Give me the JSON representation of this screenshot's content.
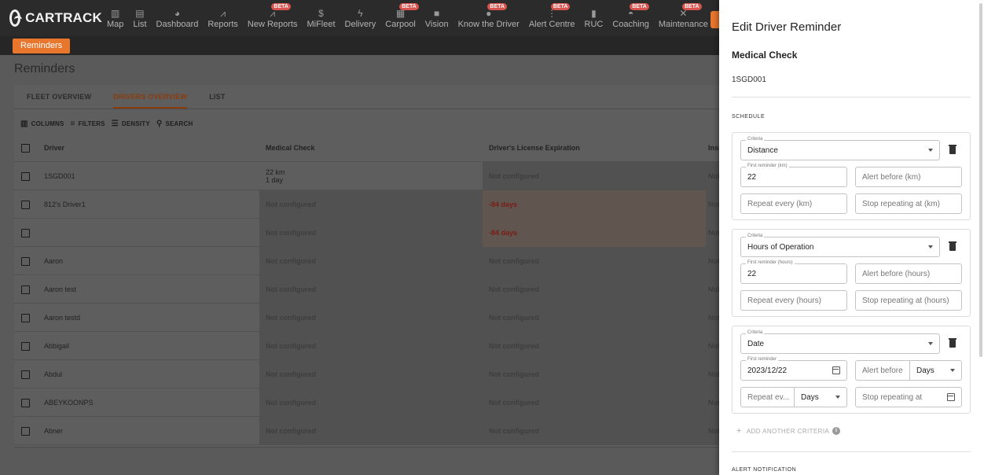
{
  "brand": {
    "name": "CARTRACK"
  },
  "nav": {
    "items": [
      {
        "label": "Map",
        "icon": "map-icon",
        "glyph": "▥",
        "beta": false
      },
      {
        "label": "List",
        "icon": "list-icon",
        "glyph": "▤",
        "beta": false
      },
      {
        "label": "Dashboard",
        "icon": "dashboard-icon",
        "glyph": "◕",
        "beta": false
      },
      {
        "label": "Reports",
        "icon": "reports-icon",
        "glyph": "⩘",
        "beta": false
      },
      {
        "label": "New Reports",
        "icon": "new-reports-icon",
        "glyph": "⩘",
        "beta": true
      },
      {
        "label": "MiFleet",
        "icon": "mifleet-icon",
        "glyph": "$",
        "beta": false
      },
      {
        "label": "Delivery",
        "icon": "delivery-icon",
        "glyph": "ϟ",
        "beta": false
      },
      {
        "label": "Carpool",
        "icon": "carpool-icon",
        "glyph": "▦",
        "beta": true
      },
      {
        "label": "Vision",
        "icon": "vision-icon",
        "glyph": "■",
        "beta": false
      },
      {
        "label": "Know the Driver",
        "icon": "driver-icon",
        "glyph": "●",
        "beta": true
      },
      {
        "label": "Alert Centre",
        "icon": "alert-icon",
        "glyph": "⋮",
        "beta": true
      },
      {
        "label": "RUC",
        "icon": "ruc-icon",
        "glyph": "▮",
        "beta": false
      },
      {
        "label": "Coaching",
        "icon": "coaching-icon",
        "glyph": "◓",
        "beta": true
      },
      {
        "label": "Maintenance",
        "icon": "maintenance-icon",
        "glyph": "✕",
        "beta": true
      }
    ],
    "beta_label": "BETA"
  },
  "subnav": {
    "button": "Reminders"
  },
  "page": {
    "title": "Reminders"
  },
  "tabs": [
    {
      "label": "FLEET OVERVIEW",
      "active": false
    },
    {
      "label": "DRIVERS OVERVIEW",
      "active": true
    },
    {
      "label": "LIST",
      "active": false
    }
  ],
  "toolbar": {
    "columns": "COLUMNS",
    "filters": "FILTERS",
    "density": "DENSITY",
    "search": "SEARCH"
  },
  "table": {
    "headers": {
      "driver": "Driver",
      "medical": "Medical Check",
      "license": "Driver's License Expiration",
      "insurance": "Insu"
    },
    "rows": [
      {
        "driver": "1SGD001",
        "medical_line1": "22 km",
        "medical_line2": "1 day",
        "license": "Not configured",
        "insurance": "Not"
      },
      {
        "driver": "812's Driver1",
        "medical_line1": "Not configured",
        "medical_line2": "",
        "license": "-84 days",
        "insurance": "Not"
      },
      {
        "driver": "",
        "medical_line1": "Not configured",
        "medical_line2": "",
        "license": "-84 days",
        "insurance": "Not"
      },
      {
        "driver": "Aaron",
        "medical_line1": "Not configured",
        "medical_line2": "",
        "license": "Not configured",
        "insurance": "Not"
      },
      {
        "driver": "Aaron test",
        "medical_line1": "Not configured",
        "medical_line2": "",
        "license": "Not configured",
        "insurance": "Not"
      },
      {
        "driver": "Aaron testd",
        "medical_line1": "Not configured",
        "medical_line2": "",
        "license": "Not configured",
        "insurance": "Not"
      },
      {
        "driver": "Abbigail",
        "medical_line1": "Not configured",
        "medical_line2": "",
        "license": "Not configured",
        "insurance": "Not"
      },
      {
        "driver": "Abdul",
        "medical_line1": "Not configured",
        "medical_line2": "",
        "license": "Not configured",
        "insurance": "Not"
      },
      {
        "driver": "ABEYKOONPS",
        "medical_line1": "Not configured",
        "medical_line2": "",
        "license": "Not configured",
        "insurance": "Not"
      },
      {
        "driver": "Abner",
        "medical_line1": "Not configured",
        "medical_line2": "",
        "license": "Not configured",
        "insurance": "Not"
      }
    ]
  },
  "drawer": {
    "title": "Edit Driver Reminder",
    "subtitle": "Medical Check",
    "driver_id": "1SGD001",
    "schedule_label": "SCHEDULE",
    "criteria_label": "Criteria",
    "distance": {
      "criteria": "Distance",
      "first_label": "First reminder (km)",
      "first_value": "22",
      "alert_before": "Alert before (km)",
      "repeat_every": "Repeat every (km)",
      "stop_repeating": "Stop repeating at (km)"
    },
    "hours": {
      "criteria": "Hours of Operation",
      "first_label": "First reminder (hours)",
      "first_value": "22",
      "alert_before": "Alert before (hours)",
      "repeat_every": "Repeat every (hours)",
      "stop_repeating": "Stop repeating at (hours)"
    },
    "date": {
      "criteria": "Date",
      "first_label": "First reminder",
      "first_value": "2023/12/22",
      "alert_before": "Alert before",
      "alert_unit": "Days",
      "repeat_every": "Repeat ev...",
      "repeat_unit": "Days",
      "stop_repeating": "Stop repeating at"
    },
    "add_criteria": "ADD ANOTHER CRITERIA",
    "alert_notification": "ALERT NOTIFICATION"
  },
  "colors": {
    "accent": "#e8762d",
    "warning_text": "#7a1c14",
    "beta_badge": "#d9534f"
  }
}
